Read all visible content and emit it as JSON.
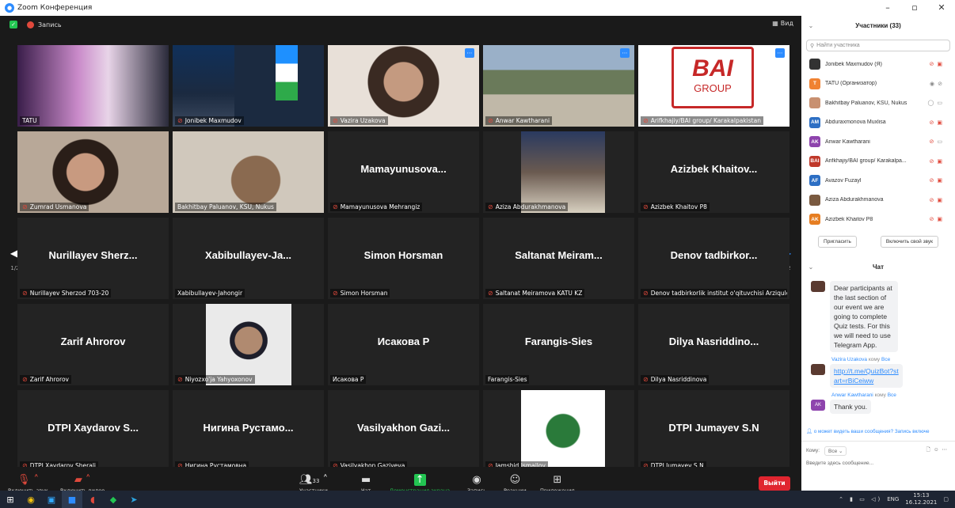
{
  "window": {
    "title": "Zoom Конференция",
    "min": "–",
    "max": "▫",
    "close": "✕"
  },
  "topbar": {
    "record": "Запись",
    "view": "Вид"
  },
  "tiles": [
    {
      "name": "TATU",
      "big": "",
      "mic": false
    },
    {
      "name": "Jonibek Maxmudov",
      "big": "",
      "mic": true
    },
    {
      "name": "Vazira Uzakova",
      "big": "",
      "mic": true
    },
    {
      "name": "Anwar Kawtharani",
      "big": "",
      "mic": true
    },
    {
      "name": "Arifkhajiy/BAI group/ Karakalpakistan",
      "big": "",
      "mic": true
    },
    {
      "name": "Zumrad Usmanova",
      "big": "",
      "mic": true
    },
    {
      "name": "Bakhitbay Paluanov, KSU, Nukus",
      "big": "",
      "mic": false
    },
    {
      "name": "Mamayunusova Mehrangiz",
      "big": "Mamayunusova...",
      "mic": true
    },
    {
      "name": "Aziza Abdurakhmanova",
      "big": "",
      "mic": true
    },
    {
      "name": "Azizbek Khaitov P8",
      "big": "Azizbek Khaitov...",
      "mic": true
    },
    {
      "name": "Nurillayev Sherzod 703-20",
      "big": "Nurillayev Sherz...",
      "mic": true
    },
    {
      "name": "Xabibullayev-Jahongir",
      "big": "Xabibullayev-Ja...",
      "mic": false
    },
    {
      "name": "Simon Horsman",
      "big": "Simon Horsman",
      "mic": true
    },
    {
      "name": "Saltanat Meiramova KATU KZ",
      "big": "Saltanat Meiram...",
      "mic": true
    },
    {
      "name": "Denov tadbirkorlik institut o'qituvchisi Arziqulo...",
      "big": "Denov tadbirkor...",
      "mic": true
    },
    {
      "name": "Zarif Ahrorov",
      "big": "Zarif Ahrorov",
      "mic": true
    },
    {
      "name": "Niyozxo'ja Yahyoxonov",
      "big": "",
      "mic": true
    },
    {
      "name": "Исакова Р",
      "big": "Исакова Р",
      "mic": false
    },
    {
      "name": "Farangis-Sies",
      "big": "Farangis-Sies",
      "mic": false
    },
    {
      "name": "Dilya Nasriddinova",
      "big": "Dilya Nasriddino...",
      "mic": true
    },
    {
      "name": "DTPI Xaydarov Sherali",
      "big": "DTPI Xaydarov S...",
      "mic": true
    },
    {
      "name": "Нигина Рустамовна",
      "big": "Нигина Рустамо...",
      "mic": true
    },
    {
      "name": "Vasilyakhon Gaziyeva",
      "big": "Vasilyakhon Gazi...",
      "mic": true
    },
    {
      "name": "Jamshid Ismailov",
      "big": "",
      "mic": true
    },
    {
      "name": "DTPI Jumayev S.N",
      "big": "DTPI Jumayev S.N",
      "mic": true
    }
  ],
  "pager": {
    "left": "1/2",
    "right": "1/2"
  },
  "bai_logo": {
    "top": "BAI",
    "bottom": "GROUP"
  },
  "controls": {
    "unmute": "Включить звук",
    "video": "Включить видео",
    "participants": "Участники",
    "participants_count": "33",
    "chat": "Чат",
    "share": "Демонстрация экрана",
    "record": "Запись",
    "reactions": "Реакции",
    "apps": "Приложения",
    "leave": "Выйти"
  },
  "panel": {
    "title": "Участники (33)",
    "search_placeholder": "Найти участника",
    "participants": [
      {
        "name": "Jonibek Maxmudov (Я)",
        "initials": "",
        "color": "#333333"
      },
      {
        "name": "TATU (Организатор)",
        "initials": "T",
        "color": "#f08232"
      },
      {
        "name": "Bakhitbay Paluanov, KSU, Nukus",
        "initials": "",
        "color": "#c89070"
      },
      {
        "name": "Abduraxmonova Muxlisa",
        "initials": "AM",
        "color": "#2d6fc4"
      },
      {
        "name": "Anwar Kawtharani",
        "initials": "AK",
        "color": "#8e44ad"
      },
      {
        "name": "Arifkhajiy/BAI group/ Karakalpa...",
        "initials": "BAI",
        "color": "#c0392b"
      },
      {
        "name": "Avazov Fuzayl",
        "initials": "AF",
        "color": "#2d6fc4"
      },
      {
        "name": "Aziza Abdurakhmanova",
        "initials": "",
        "color": "#7a5a40"
      },
      {
        "name": "Azizbek Khaitov P8",
        "initials": "AK",
        "color": "#e67e22"
      }
    ],
    "invite": "Пригласить",
    "unmute_me": "Включить свой звук",
    "chat_title": "Чат",
    "msg1": "Dear participants at the last section of our event we are going to complete Quiz tests. For this we will need to use Telegram App.",
    "sender2": "Vazira Uzakova",
    "to_word": "кому",
    "all": "Все",
    "msg2": "http://t.me/QuizBot?start=rBiCeiww",
    "sender3": "Anwar Kawtharani",
    "msg3_initials": "AK",
    "msg3": "Thank you.",
    "notice": "о может видеть ваши сообщения? Запись включе",
    "to_label": "Кому:",
    "to_value": "Все",
    "input_placeholder": "Введите здесь сообщение..."
  },
  "taskbar": {
    "lang": "ENG",
    "time": "15:13",
    "date": "16.12.2021"
  }
}
